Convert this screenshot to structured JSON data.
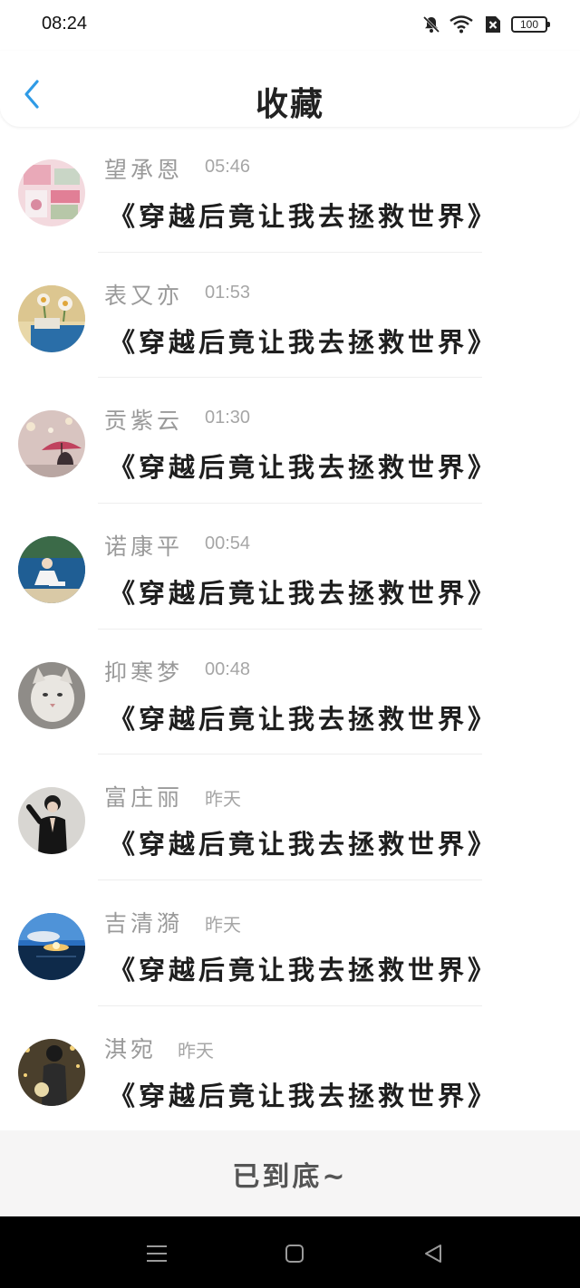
{
  "status_bar": {
    "time": "08:24",
    "battery": "100",
    "icons": [
      "mute-bell-icon",
      "wifi-icon",
      "sim-off-icon",
      "battery-icon"
    ]
  },
  "header": {
    "title": "收藏",
    "back_icon": "chevron-left-icon",
    "accent_color": "#2F9BE6"
  },
  "items": [
    {
      "name": "望承恩",
      "time": "05:46",
      "message": "《穿越后竟让我去拯救世界》",
      "avatar": "avatar-pink-collage"
    },
    {
      "name": "表又亦",
      "time": "01:53",
      "message": "《穿越后竟让我去拯救世界》",
      "avatar": "avatar-flower-cup"
    },
    {
      "name": "贡紫云",
      "time": "01:30",
      "message": "《穿越后竟让我去拯救世界》",
      "avatar": "avatar-umbrella-street"
    },
    {
      "name": "诺康平",
      "time": "00:54",
      "message": "《穿越后竟让我去拯救世界》",
      "avatar": "avatar-person-lake"
    },
    {
      "name": "抑寒梦",
      "time": "00:48",
      "message": "《穿越后竟让我去拯救世界》",
      "avatar": "avatar-white-cat"
    },
    {
      "name": "富庄丽",
      "time": "昨天",
      "message": "《穿越后竟让我去拯救世界》",
      "avatar": "avatar-man-black-shirt"
    },
    {
      "name": "吉清漪",
      "time": "昨天",
      "message": "《穿越后竟让我去拯救世界》",
      "avatar": "avatar-sunset-sea"
    },
    {
      "name": "淇宛",
      "time": "昨天",
      "message": "《穿越后竟让我去拯救世界》",
      "avatar": "avatar-person-lights"
    }
  ],
  "footer": {
    "end_text": "已到底~"
  },
  "nav_bar": {
    "icons": [
      "menu-icon",
      "home-square-icon",
      "back-triangle-icon"
    ]
  }
}
